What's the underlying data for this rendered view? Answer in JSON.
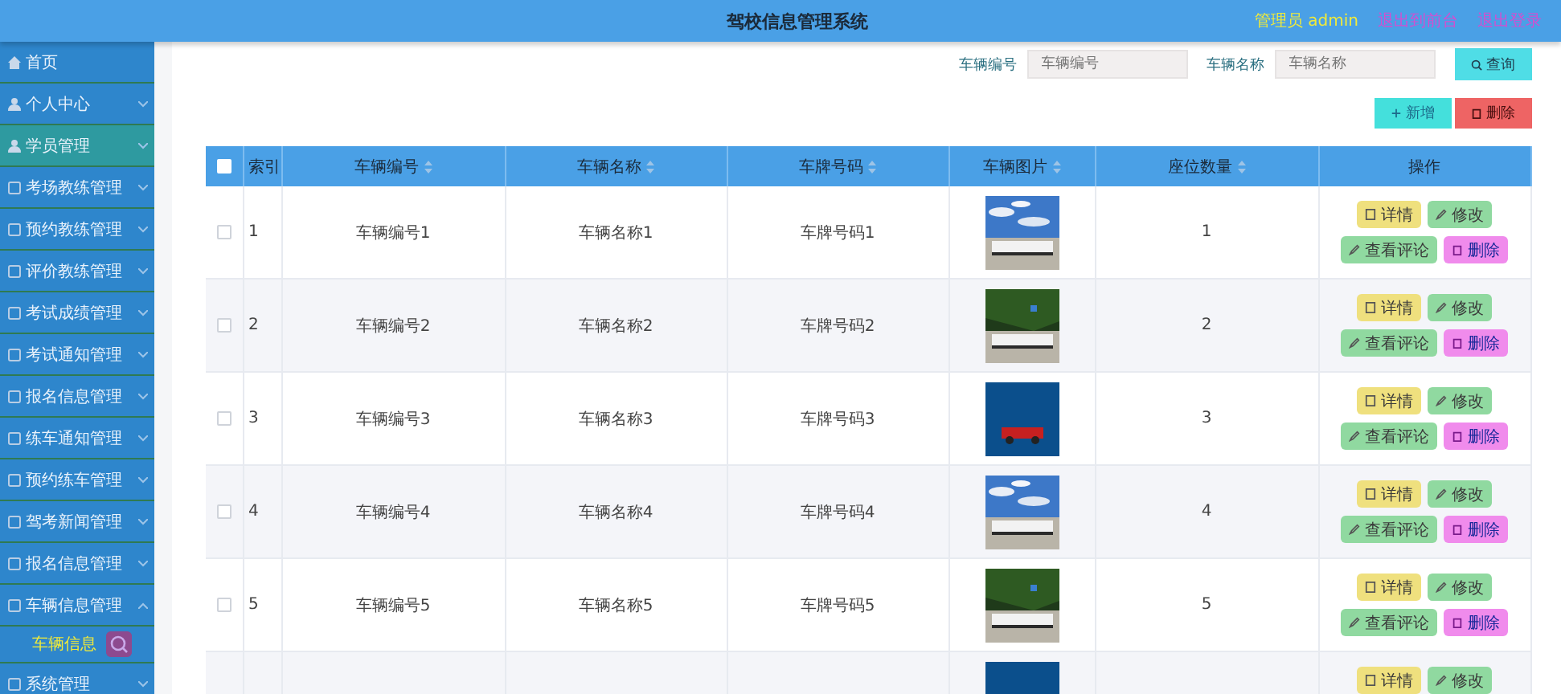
{
  "header": {
    "title": "驾校信息管理系统",
    "user": "管理员 admin",
    "links": [
      "退出到前台",
      "退出登录"
    ]
  },
  "sidebar": {
    "items": [
      {
        "label": "首页",
        "kind": "link",
        "selected": false
      },
      {
        "label": "个人中心",
        "kind": "group",
        "selected": false,
        "expanded": false
      },
      {
        "label": "学员管理",
        "kind": "group",
        "selected": true,
        "expanded": false
      },
      {
        "label": "考场教练管理",
        "kind": "group",
        "selected": false,
        "expanded": false
      },
      {
        "label": "预约教练管理",
        "kind": "group",
        "selected": false,
        "expanded": false
      },
      {
        "label": "评价教练管理",
        "kind": "group",
        "selected": false,
        "expanded": false
      },
      {
        "label": "考试成绩管理",
        "kind": "group",
        "selected": false,
        "expanded": false
      },
      {
        "label": "考试通知管理",
        "kind": "group",
        "selected": false,
        "expanded": false
      },
      {
        "label": "报名信息管理",
        "kind": "group",
        "selected": false,
        "expanded": false
      },
      {
        "label": "练车通知管理",
        "kind": "group",
        "selected": false,
        "expanded": false
      },
      {
        "label": "预约练车管理",
        "kind": "group",
        "selected": false,
        "expanded": false
      },
      {
        "label": "驾考新闻管理",
        "kind": "group",
        "selected": false,
        "expanded": false
      },
      {
        "label": "报名信息管理",
        "kind": "group",
        "selected": false,
        "expanded": false
      },
      {
        "label": "车辆信息管理",
        "kind": "group",
        "selected": false,
        "expanded": true,
        "children": [
          {
            "label": "车辆信息",
            "selected": true
          }
        ]
      },
      {
        "label": "系统管理",
        "kind": "group",
        "selected": false,
        "expanded": false
      }
    ]
  },
  "search": {
    "fields": [
      {
        "label": "车辆编号",
        "placeholder": "车辆编号"
      },
      {
        "label": "车辆名称",
        "placeholder": "车辆名称"
      }
    ],
    "button": "查询"
  },
  "toolbar": [
    {
      "label": "新增",
      "kind": "add"
    },
    {
      "label": "删除",
      "kind": "delete"
    }
  ],
  "table": {
    "all_checked": false,
    "columns": [
      {
        "label": "索引",
        "sortable": false
      },
      {
        "label": "车辆编号",
        "sortable": true
      },
      {
        "label": "车辆名称",
        "sortable": true
      },
      {
        "label": "车牌号码",
        "sortable": true
      },
      {
        "label": "车辆图片",
        "sortable": true
      },
      {
        "label": "座位数量",
        "sortable": true
      },
      {
        "label": "操作",
        "sortable": false
      }
    ],
    "rows": [
      {
        "checked": false,
        "index": "1",
        "code": "车辆编号1",
        "name": "车辆名称1",
        "plate": "车牌号码1",
        "seats": "1",
        "actions": [
          {
            "label": "详情",
            "kind": "detail"
          },
          {
            "label": "修改",
            "kind": "edit"
          },
          {
            "label": "查看评论",
            "kind": "comment"
          },
          {
            "label": "删除",
            "kind": "delete"
          }
        ]
      },
      {
        "checked": false,
        "index": "2",
        "code": "车辆编号2",
        "name": "车辆名称2",
        "plate": "车牌号码2",
        "seats": "2",
        "actions": [
          {
            "label": "详情",
            "kind": "detail"
          },
          {
            "label": "修改",
            "kind": "edit"
          },
          {
            "label": "查看评论",
            "kind": "comment"
          },
          {
            "label": "删除",
            "kind": "delete"
          }
        ]
      },
      {
        "checked": false,
        "index": "3",
        "code": "车辆编号3",
        "name": "车辆名称3",
        "plate": "车牌号码3",
        "seats": "3",
        "actions": [
          {
            "label": "详情",
            "kind": "detail"
          },
          {
            "label": "修改",
            "kind": "edit"
          },
          {
            "label": "查看评论",
            "kind": "comment"
          },
          {
            "label": "删除",
            "kind": "delete"
          }
        ]
      },
      {
        "checked": false,
        "index": "4",
        "code": "车辆编号4",
        "name": "车辆名称4",
        "plate": "车牌号码4",
        "seats": "4",
        "actions": [
          {
            "label": "详情",
            "kind": "detail"
          },
          {
            "label": "修改",
            "kind": "edit"
          },
          {
            "label": "查看评论",
            "kind": "comment"
          },
          {
            "label": "删除",
            "kind": "delete"
          }
        ]
      },
      {
        "checked": false,
        "index": "5",
        "code": "车辆编号5",
        "name": "车辆名称5",
        "plate": "车牌号码5",
        "seats": "5",
        "actions": [
          {
            "label": "详情",
            "kind": "detail"
          },
          {
            "label": "修改",
            "kind": "edit"
          },
          {
            "label": "查看评论",
            "kind": "comment"
          },
          {
            "label": "删除",
            "kind": "delete"
          }
        ]
      },
      {
        "actions": [
          {
            "label": "详情",
            "kind": "detail"
          },
          {
            "label": "修改",
            "kind": "edit"
          }
        ]
      }
    ]
  }
}
